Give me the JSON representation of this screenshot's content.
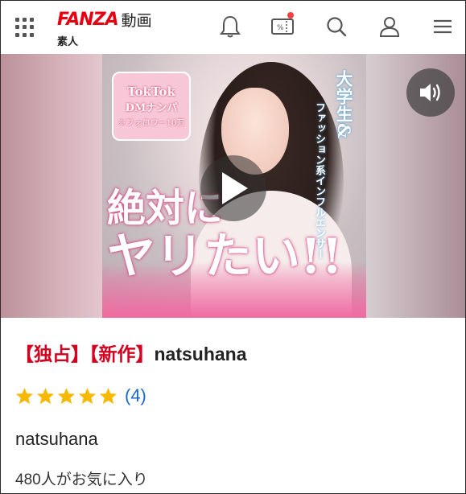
{
  "header": {
    "logo_brand": "FANZA",
    "logo_service": "動画",
    "sub_label": "素人",
    "icons": [
      "grid-menu-icon",
      "bell-icon",
      "coupon-icon",
      "search-icon",
      "user-icon",
      "hamburger-menu-icon"
    ],
    "coupon_text": "%",
    "colors": {
      "brand_red": "#e60012",
      "badge_red": "#ff3d3d"
    }
  },
  "video": {
    "thumb_badge": {
      "line1": "TokTok",
      "line2": "DMナンパ",
      "line3": "※フォロワー10万"
    },
    "vertical_text_main": "大学生&",
    "vertical_text_sub": "ファッション系インフルエンサー",
    "headline_line1": "絶対に",
    "headline_line2": "ヤリたい!!",
    "play_icon": "play-icon",
    "volume_icon": "volume-icon"
  },
  "product": {
    "tag_exclusive": "【独占】",
    "tag_new": "【新作】",
    "title_name": "natsuhana",
    "rating_stars": 5,
    "review_count": "(4)",
    "actress": "natsuhana",
    "favorites": "480人がお気に入り",
    "colors": {
      "tag_red": "#d4001f",
      "star_yellow": "#f6b900",
      "link_blue": "#1a6ac9"
    }
  }
}
